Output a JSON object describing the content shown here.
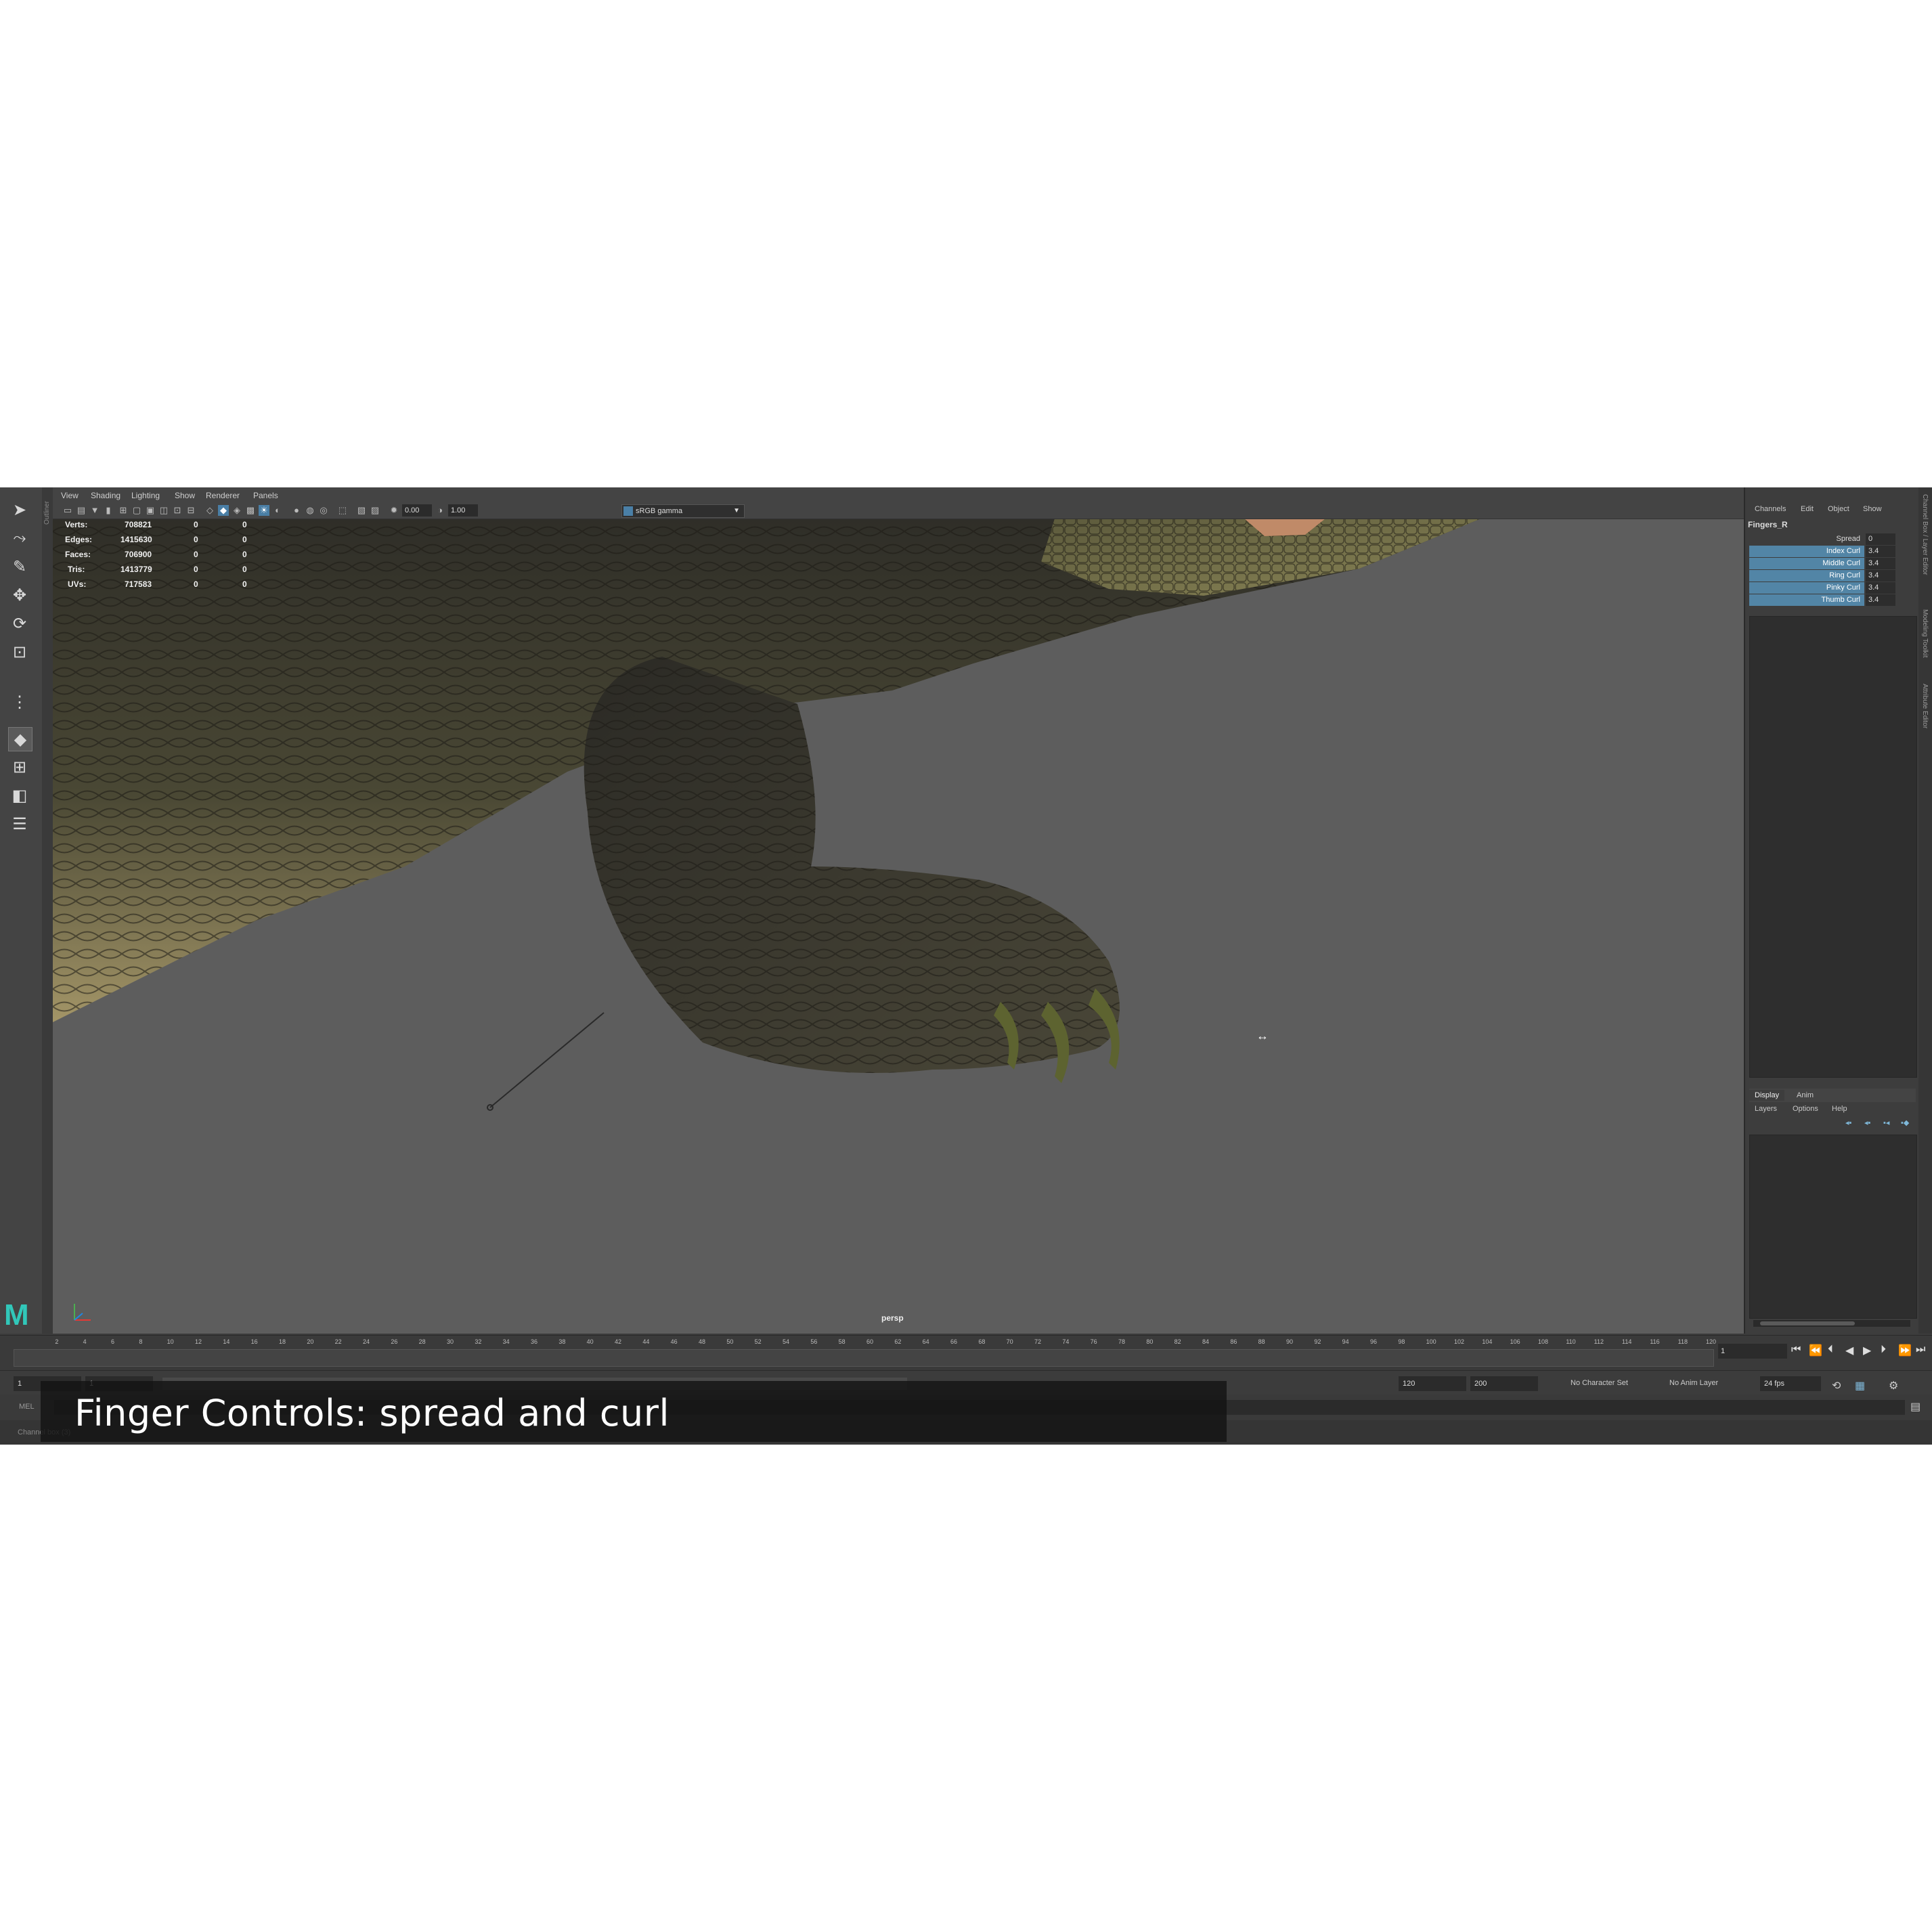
{
  "app": {
    "name": "Maya",
    "logo_letter": "M"
  },
  "viewport": {
    "menus": [
      "View",
      "Shading",
      "Lighting",
      "Show",
      "Renderer",
      "Panels"
    ],
    "exposure_value": "0.00",
    "gamma_value": "1.00",
    "color_space": "sRGB gamma",
    "camera_label": "persp"
  },
  "hud": {
    "rows": [
      {
        "label": "Verts:",
        "v1": "708821",
        "v2": "0",
        "v3": "0"
      },
      {
        "label": "Edges:",
        "v1": "1415630",
        "v2": "0",
        "v3": "0"
      },
      {
        "label": "Faces:",
        "v1": "706900",
        "v2": "0",
        "v3": "0"
      },
      {
        "label": "Tris:",
        "v1": "1413779",
        "v2": "0",
        "v3": "0"
      },
      {
        "label": "UVs:",
        "v1": "717583",
        "v2": "0",
        "v3": "0"
      }
    ]
  },
  "outliner_tab": "Outliner",
  "channel_box": {
    "menus": [
      "Channels",
      "Edit",
      "Object",
      "Show"
    ],
    "node_name": "Fingers_R",
    "attributes": [
      {
        "name": "Spread",
        "value": "0",
        "selected": false
      },
      {
        "name": "Index Curl",
        "value": "3.4",
        "selected": true
      },
      {
        "name": "Middle Curl",
        "value": "3.4",
        "selected": true
      },
      {
        "name": "Ring Curl",
        "value": "3.4",
        "selected": true
      },
      {
        "name": "Pinky Curl",
        "value": "3.4",
        "selected": true
      },
      {
        "name": "Thumb Curl",
        "value": "3.4",
        "selected": true
      }
    ],
    "side_tabs": [
      "Channel Box / Layer Editor",
      "Modeling Toolkit",
      "Attribute Editor"
    ]
  },
  "layer_editor": {
    "tabs": [
      "Display",
      "Anim"
    ],
    "menus": [
      "Layers",
      "Options",
      "Help"
    ]
  },
  "timeline": {
    "ticks": [
      "2",
      "4",
      "6",
      "8",
      "10",
      "12",
      "14",
      "16",
      "18",
      "20",
      "22",
      "24",
      "26",
      "28",
      "30",
      "32",
      "34",
      "36",
      "38",
      "40",
      "42",
      "44",
      "46",
      "48",
      "50",
      "52",
      "54",
      "56",
      "58",
      "60",
      "62",
      "64",
      "66",
      "68",
      "70",
      "72",
      "74",
      "76",
      "78",
      "80",
      "82",
      "84",
      "86",
      "88",
      "90",
      "92",
      "94",
      "96",
      "98",
      "100",
      "102",
      "104",
      "106",
      "108",
      "110",
      "112",
      "114",
      "116",
      "118",
      "120"
    ],
    "current_frame": "1",
    "range_start": "1",
    "range_inner_start": "1",
    "range_inner_end": "120",
    "range_end": "120",
    "anim_end": "200",
    "character_set": "No Character Set",
    "anim_layer": "No Anim Layer",
    "fps": "24 fps"
  },
  "command_line": {
    "language": "MEL"
  },
  "status_line": {
    "text": "Channel box (3)"
  },
  "caption": "Finger Controls: spread and curl"
}
